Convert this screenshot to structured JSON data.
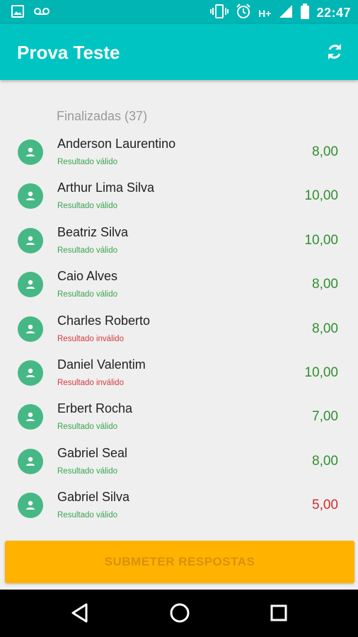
{
  "status_bar": {
    "time": "22:47",
    "network": "H+",
    "icons": [
      "image-icon",
      "voicemail-icon",
      "vibrate-icon",
      "alarm-icon",
      "signal-icon",
      "battery-icon"
    ]
  },
  "app_bar": {
    "title": "Prova Teste",
    "action_icon": "refresh-icon"
  },
  "section": {
    "label": "Finalizadas (37)"
  },
  "students": [
    {
      "name": "Anderson Laurentino",
      "status": "Resultado válido",
      "valid": true,
      "score": "8,00",
      "score_color": "good"
    },
    {
      "name": "Arthur Lima Silva",
      "status": "Resultado válido",
      "valid": true,
      "score": "10,00",
      "score_color": "good"
    },
    {
      "name": "Beatriz Silva",
      "status": "Resultado válido",
      "valid": true,
      "score": "10,00",
      "score_color": "good"
    },
    {
      "name": "Caio Alves",
      "status": "Resultado válido",
      "valid": true,
      "score": "8,00",
      "score_color": "good"
    },
    {
      "name": "Charles Roberto",
      "status": "Resultado inválido",
      "valid": false,
      "score": "8,00",
      "score_color": "good"
    },
    {
      "name": "Daniel Valentim",
      "status": "Resultado inválido",
      "valid": false,
      "score": "10,00",
      "score_color": "good"
    },
    {
      "name": "Erbert Rocha",
      "status": "Resultado válido",
      "valid": true,
      "score": "7,00",
      "score_color": "good"
    },
    {
      "name": "Gabriel Seal",
      "status": "Resultado válido",
      "valid": true,
      "score": "8,00",
      "score_color": "good"
    },
    {
      "name": "Gabriel Silva",
      "status": "Resultado válido",
      "valid": true,
      "score": "5,00",
      "score_color": "bad"
    }
  ],
  "submit_button": {
    "label": "SUBMETER RESPOSTAS"
  },
  "colors": {
    "primary": "#00c4c2",
    "status_bar": "#00b5b3",
    "avatar": "#46b886",
    "valid": "#3aa54f",
    "invalid": "#d43b3b",
    "accent": "#ffb300"
  }
}
